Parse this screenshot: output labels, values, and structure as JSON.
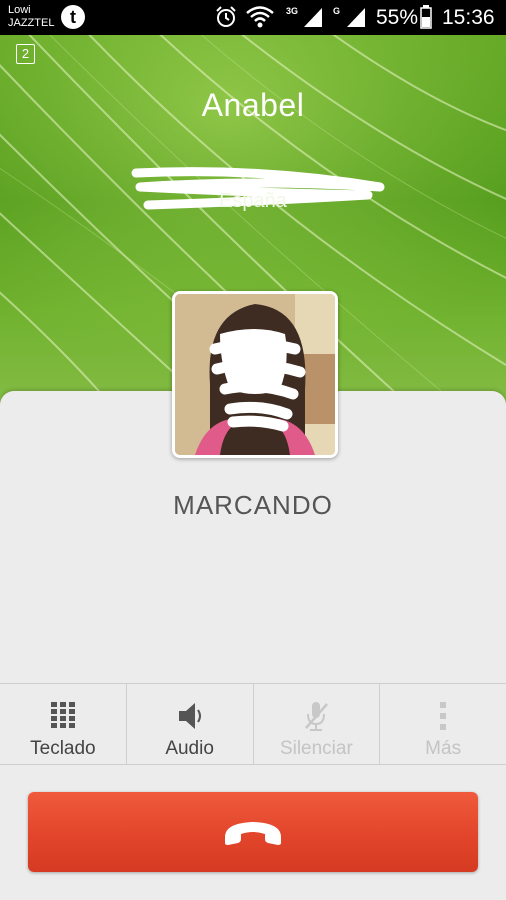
{
  "status_bar": {
    "carrier_line1": "Lowi",
    "carrier_line2": "JAZZTEL",
    "tuenti_icon_letter": "t",
    "net_label_1": "3G",
    "net_label_2": "G",
    "battery": "55%",
    "time": "15:36"
  },
  "call": {
    "sim_slot": "2",
    "caller_name": "Anabel",
    "caller_country": "España",
    "state": "MARCANDO"
  },
  "actions": [
    {
      "label": "Teclado",
      "icon": "keypad-icon",
      "enabled": true
    },
    {
      "label": "Audio",
      "icon": "speaker-icon",
      "enabled": true
    },
    {
      "label": "Silenciar",
      "icon": "mic-mute-icon",
      "enabled": false
    },
    {
      "label": "Más",
      "icon": "more-vertical-icon",
      "enabled": false
    }
  ],
  "end_call": {
    "icon": "hang-up-icon"
  },
  "colors": {
    "accent_end_call": "#e2452b",
    "hero_green": "#72b52c",
    "panel_bg": "#ececec"
  }
}
